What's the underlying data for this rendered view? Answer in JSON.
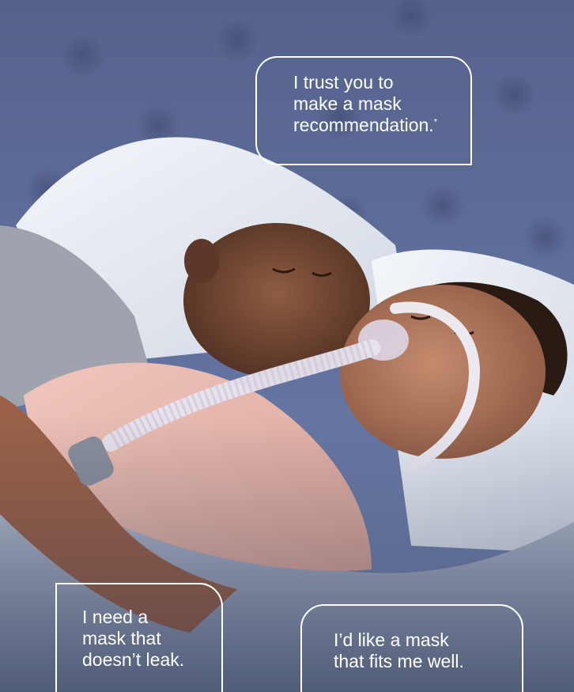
{
  "photo": {
    "alt": "",
    "colors": {
      "headboard": "#5b6792",
      "pillow": "#e8edf3",
      "woman_shirt": "#e7b7ad",
      "woman_skin": "#b47a5f",
      "man_skin": "#7a4d36",
      "mask": "#e6e0ea",
      "blanket": "#aeb5c6"
    }
  },
  "bubbles": {
    "top": {
      "text": "I trust you to\nmake a mask\nrecommendation.",
      "footnote_mark": "*"
    },
    "bottom_left": {
      "text": "I need a\nmask that\ndoesn’t leak."
    },
    "bottom_right": {
      "text": "I’d like a mask\nthat fits me well."
    }
  }
}
